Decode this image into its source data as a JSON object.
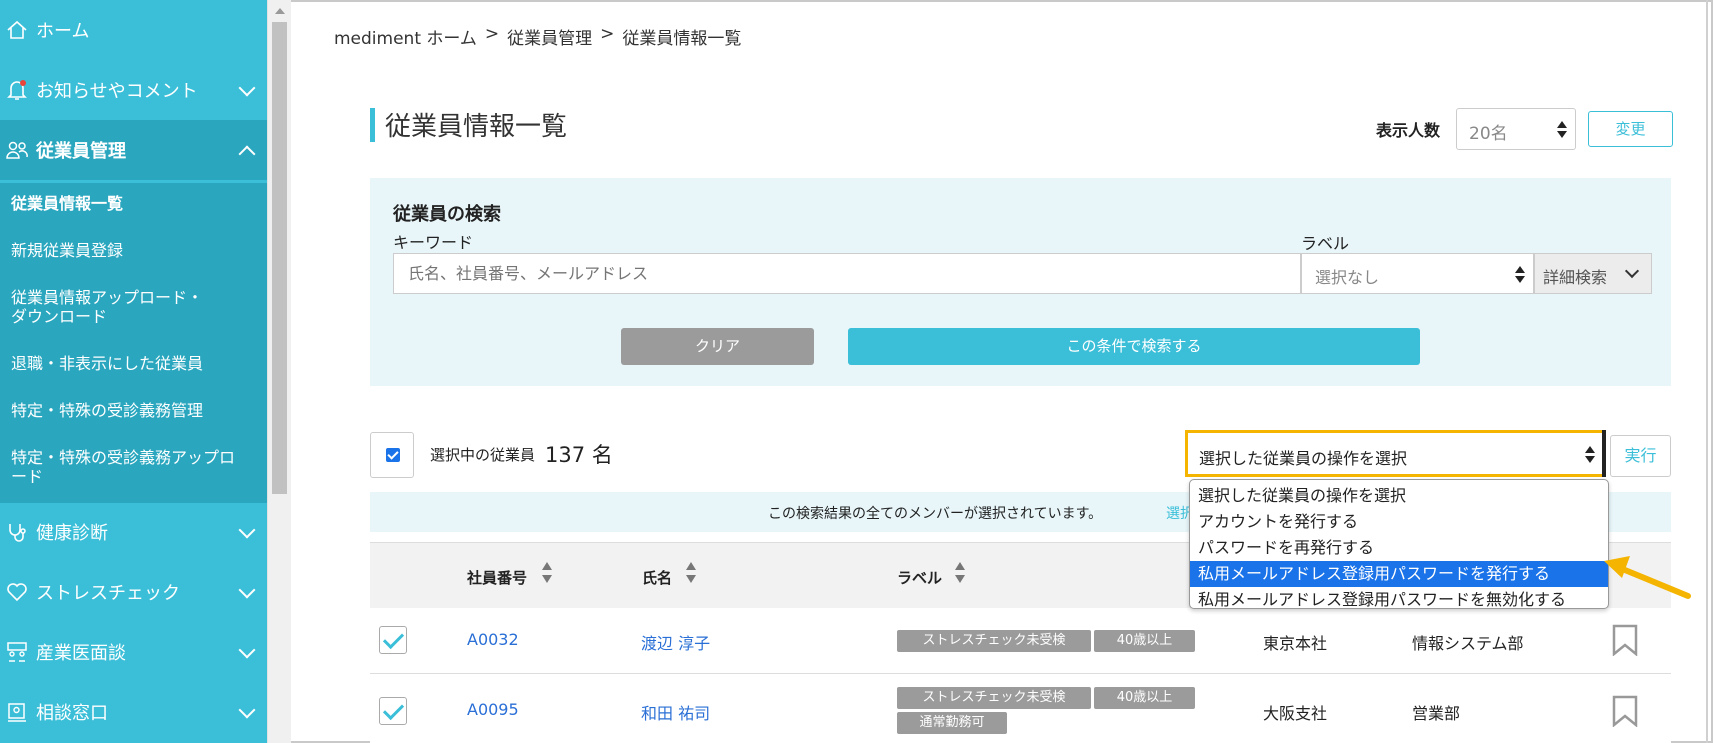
{
  "sidebar": {
    "items": [
      {
        "label": "ホーム",
        "icon": "home-icon"
      },
      {
        "label": "お知らせやコメント",
        "icon": "bell-icon"
      },
      {
        "label": "従業員管理",
        "icon": "people-icon"
      },
      {
        "label": "健康診断",
        "icon": "stethoscope-icon"
      },
      {
        "label": "ストレスチェック",
        "icon": "heart-icon"
      },
      {
        "label": "産業医面談",
        "icon": "meeting-icon"
      },
      {
        "label": "相談窓口",
        "icon": "chat-icon"
      }
    ],
    "sub_items": [
      "従業員情報一覧",
      "新規従業員登録",
      "従業員情報アップロード・ダウンロード",
      "退職・非表示にした従業員",
      "特定・特殊の受診義務管理",
      "特定・特殊の受診義務アップロード"
    ],
    "accent": "#3bbfd8"
  },
  "breadcrumb": [
    "mediment ホーム",
    ">",
    "従業員管理",
    ">",
    "従業員情報一覧"
  ],
  "page_title": "従業員情報一覧",
  "display_count": {
    "label": "表示人数",
    "value": "20名",
    "button": "変更"
  },
  "search": {
    "title": "従業員の検索",
    "keyword_label": "キーワード",
    "keyword_placeholder": "氏名、社員番号、メールアドレス",
    "label_label": "ラベル",
    "label_value": "選択なし",
    "detail_button": "詳細検索",
    "clear_button": "クリア",
    "submit_button": "この条件で検索する"
  },
  "selection": {
    "text": "選択中の従業員",
    "count": "137 名",
    "operation_value": "選択した従業員の操作を選択",
    "execute_button": "実行",
    "info_text": "この検索結果の全てのメンバーが選択されています。",
    "info_link": "選択"
  },
  "dropdown": {
    "options": [
      "選択した従業員の操作を選択",
      "アカウントを発行する",
      "パスワードを再発行する",
      "私用メールアドレス登録用パスワードを発行する",
      "私用メールアドレス登録用パスワードを無効化する"
    ],
    "highlighted_index": 3
  },
  "table": {
    "headers": [
      "社員番号",
      "氏名",
      "ラベル"
    ],
    "rows": [
      {
        "id": "A0032",
        "name": "渡辺 淳子",
        "tags": [
          "ストレスチェック未受検",
          "40歳以上"
        ],
        "office": "東京本社",
        "dept": "情報システム部"
      },
      {
        "id": "A0095",
        "name": "和田 祐司",
        "tags": [
          "ストレスチェック未受検",
          "40歳以上",
          "通常勤務可"
        ],
        "office": "大阪支社",
        "dept": "営業部"
      }
    ]
  },
  "colors": {
    "accent": "#3bbfd8",
    "highlight": "#f4b400",
    "select_blue": "#1a73e8"
  }
}
